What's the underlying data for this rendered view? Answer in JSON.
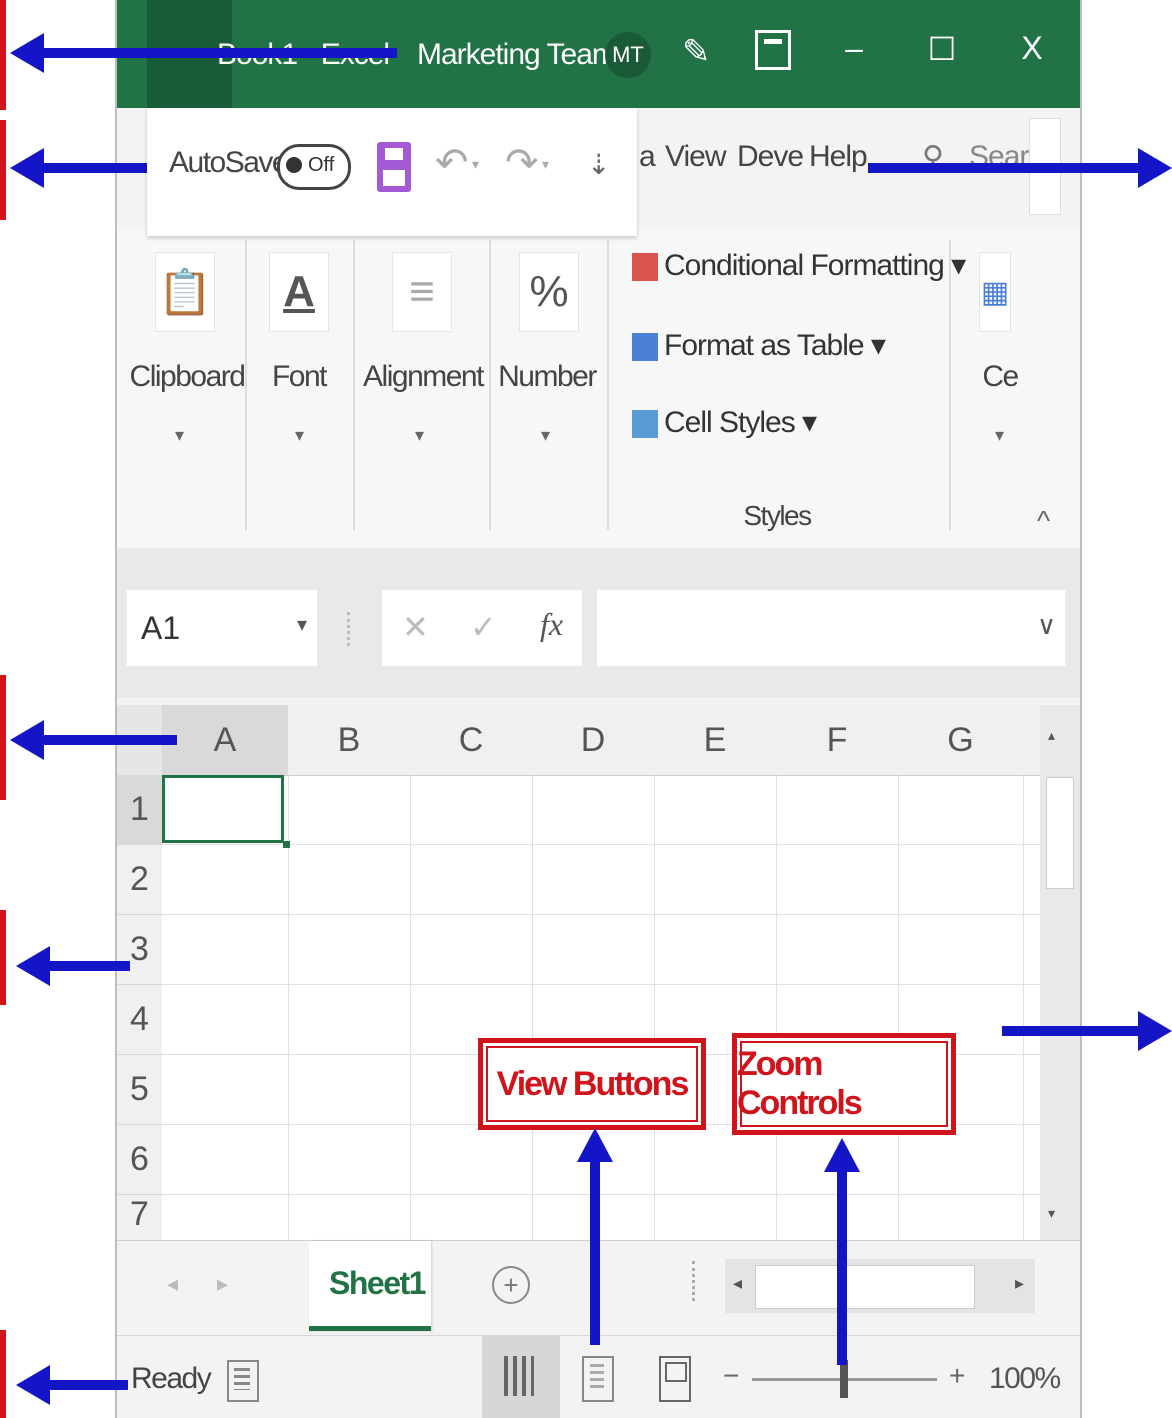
{
  "titlebar": {
    "workbook": "Book1 - Excel",
    "team": "Marketing Team",
    "avatar": "MT",
    "minimize": "–",
    "maximize": "☐",
    "close": "X",
    "color": "#217346"
  },
  "qat": {
    "autosave": "AutoSave",
    "toggle": "Off",
    "undo_caret": "▾",
    "redo_caret": "▾",
    "customize": "⇣"
  },
  "tabs": {
    "partial": "a",
    "view": "View",
    "developer": "Deve",
    "help": "Help",
    "search": "Search"
  },
  "ribbon": {
    "groups": [
      {
        "label": "Clipboard",
        "icon": "📋"
      },
      {
        "label": "Font",
        "icon": "A"
      },
      {
        "label": "Alignment",
        "icon": "≡"
      },
      {
        "label": "Number",
        "icon": "%"
      }
    ],
    "styles": {
      "conditional": "Conditional Formatting ▾",
      "format_table": "Format as Table ▾",
      "cell_styles": "Cell Styles ▾",
      "label": "Styles"
    },
    "cells_partial": "Ce",
    "collapse": "^"
  },
  "formula_bar": {
    "name_box": "A1",
    "name_caret": "▾",
    "cancel": "✕",
    "enter": "✓",
    "fx": "fx",
    "expand": "∨"
  },
  "grid": {
    "columns": [
      "A",
      "B",
      "C",
      "D",
      "E",
      "F",
      "G"
    ],
    "rows": [
      "1",
      "2",
      "3",
      "4",
      "5",
      "6",
      "7"
    ]
  },
  "sheets": {
    "active": "Sheet1",
    "add": "+"
  },
  "status": {
    "ready": "Ready",
    "zoom_minus": "−",
    "zoom_plus": "+",
    "zoom": "100%"
  },
  "callouts": {
    "view_buttons": "View Buttons",
    "zoom_controls": "Zoom Controls"
  }
}
